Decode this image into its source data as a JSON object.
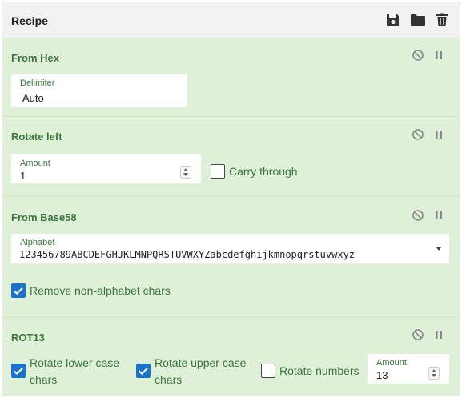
{
  "header": {
    "title": "Recipe",
    "icons": [
      "save-icon",
      "folder-icon",
      "trash-icon"
    ]
  },
  "operations": [
    {
      "title": "From Hex",
      "fields": [
        {
          "label": "Delimiter",
          "value": "Auto"
        }
      ]
    },
    {
      "title": "Rotate left",
      "fields": [
        {
          "label": "Amount",
          "value": "1"
        }
      ],
      "checkboxes": [
        {
          "label": "Carry through",
          "checked": false
        }
      ]
    },
    {
      "title": "From Base58",
      "fields": [
        {
          "label": "Alphabet",
          "value": "123456789ABCDEFGHJKLMNPQRSTUVWXYZabcdefghijkmnopqrstuvwxyz"
        }
      ],
      "checkboxes": [
        {
          "label": "Remove non-alphabet chars",
          "checked": true
        }
      ]
    },
    {
      "title": "ROT13",
      "checkboxes": [
        {
          "label_line1": "Rotate lower case",
          "label_line2": "chars",
          "checked": true
        },
        {
          "label_line1": "Rotate upper case",
          "label_line2": "chars",
          "checked": true
        },
        {
          "label": "Rotate numbers",
          "checked": false
        }
      ],
      "fields": [
        {
          "label": "Amount",
          "value": "13"
        }
      ]
    }
  ],
  "colors": {
    "op_background": "#dff0d8",
    "op_text": "#3c763d",
    "checkbox_checked": "#1a73c8",
    "header_background": "#f2f2f2"
  },
  "op_icons": [
    "disable-icon",
    "breakpoint-icon"
  ]
}
